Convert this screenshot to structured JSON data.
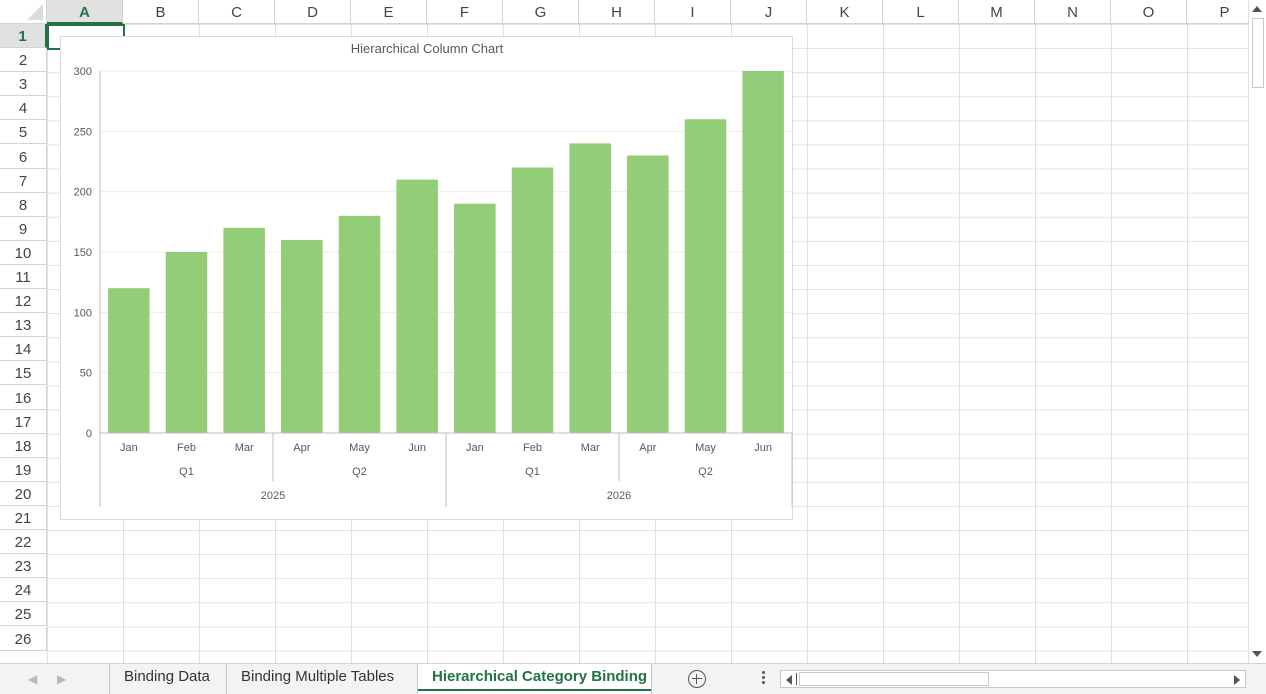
{
  "columns": [
    "A",
    "B",
    "C",
    "D",
    "E",
    "F",
    "G",
    "H",
    "I",
    "J",
    "K",
    "L",
    "M",
    "N",
    "O",
    "P"
  ],
  "rows": [
    "1",
    "2",
    "3",
    "4",
    "5",
    "6",
    "7",
    "8",
    "9",
    "10",
    "11",
    "12",
    "13",
    "14",
    "15",
    "16",
    "17",
    "18",
    "19",
    "20",
    "21",
    "22",
    "23",
    "24",
    "25",
    "26"
  ],
  "active_cell": {
    "column": "A",
    "row": "1"
  },
  "sheet_tabs": [
    {
      "label": "Binding Data",
      "active": false
    },
    {
      "label": "Binding Multiple Tables",
      "active": false
    },
    {
      "label": "Hierarchical Category Binding",
      "active": true
    }
  ],
  "colors": {
    "bar": "#93cd77",
    "active": "#217346",
    "axis_text": "#595959"
  },
  "chart_data": {
    "type": "bar",
    "title": "Hierarchical Column Chart",
    "categories": [
      "Jan",
      "Feb",
      "Mar",
      "Apr",
      "May",
      "Jun",
      "Jan",
      "Feb",
      "Mar",
      "Apr",
      "May",
      "Jun"
    ],
    "quarters": [
      {
        "label": "Q1",
        "span": 3
      },
      {
        "label": "Q2",
        "span": 3
      },
      {
        "label": "Q1",
        "span": 3
      },
      {
        "label": "Q2",
        "span": 3
      }
    ],
    "years": [
      {
        "label": "2025",
        "span": 6
      },
      {
        "label": "2026",
        "span": 6
      }
    ],
    "values": [
      120,
      150,
      170,
      160,
      180,
      210,
      190,
      220,
      240,
      230,
      260,
      300
    ],
    "yticks": [
      0,
      50,
      100,
      150,
      200,
      250,
      300
    ],
    "ylim": [
      0,
      300
    ],
    "grid": true,
    "legend": "none"
  }
}
